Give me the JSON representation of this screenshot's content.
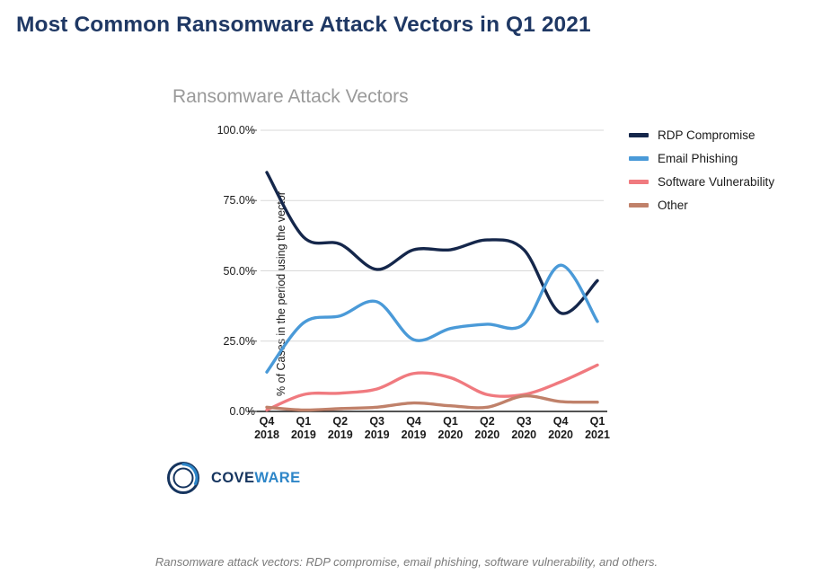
{
  "page": {
    "title": "Most Common Ransomware Attack Vectors in Q1 2021",
    "title_color": "#1f3864",
    "caption": "Ransomware attack vectors: RDP compromise, email phishing, software vulnerability, and others."
  },
  "branding": {
    "logo_text_part1": "COVE",
    "logo_text_part2": "WARE",
    "logo_color_dark": "#16355f",
    "logo_color_light": "#2e86c8",
    "logo_icon": "coveware-ring-icon"
  },
  "legend": {
    "position": "right",
    "items": [
      {
        "label": "RDP Compromise",
        "color": "#15274b"
      },
      {
        "label": "Email Phishing",
        "color": "#4a9ad8"
      },
      {
        "label": "Software Vulnerability",
        "color": "#f07a7f"
      },
      {
        "label": "Other",
        "color": "#c0816a"
      }
    ]
  },
  "chart_data": {
    "type": "line",
    "title": "Ransomware Attack Vectors",
    "title_color": "#9a9a9a",
    "xlabel": "",
    "ylabel": "% of Cases in the period using the vector",
    "ylim": [
      0,
      100
    ],
    "yticks": [
      0,
      25,
      50,
      75,
      100
    ],
    "ytick_labels": [
      "0.0%",
      "25.0%",
      "50.0%",
      "75.0%",
      "100.0%"
    ],
    "grid": true,
    "smoothing": "spline",
    "categories": [
      "Q4 2018",
      "Q1 2019",
      "Q2 2019",
      "Q3 2019",
      "Q4 2019",
      "Q1 2020",
      "Q2 2020",
      "Q3 2020",
      "Q4 2020",
      "Q1 2021"
    ],
    "category_lines": [
      [
        "Q4",
        "2018"
      ],
      [
        "Q1",
        "2019"
      ],
      [
        "Q2",
        "2019"
      ],
      [
        "Q3",
        "2019"
      ],
      [
        "Q4",
        "2019"
      ],
      [
        "Q1",
        "2020"
      ],
      [
        "Q2",
        "2020"
      ],
      [
        "Q3",
        "2020"
      ],
      [
        "Q4",
        "2020"
      ],
      [
        "Q1",
        "2021"
      ]
    ],
    "series": [
      {
        "name": "RDP Compromise",
        "color": "#15274b",
        "values": [
          85.0,
          62.0,
          59.5,
          50.5,
          57.5,
          57.5,
          61.0,
          57.5,
          35.0,
          46.5
        ]
      },
      {
        "name": "Email Phishing",
        "color": "#4a9ad8",
        "values": [
          14.0,
          31.5,
          34.0,
          39.0,
          25.5,
          29.5,
          31.0,
          31.0,
          52.0,
          32.0
        ]
      },
      {
        "name": "Software Vulnerability",
        "color": "#f07a7f",
        "values": [
          0.5,
          6.0,
          6.5,
          8.0,
          13.5,
          12.0,
          6.0,
          6.0,
          10.5,
          16.5
        ]
      },
      {
        "name": "Other",
        "color": "#c0816a",
        "values": [
          1.5,
          0.5,
          1.0,
          1.5,
          3.0,
          2.0,
          1.5,
          5.5,
          3.5,
          3.3
        ]
      }
    ]
  }
}
